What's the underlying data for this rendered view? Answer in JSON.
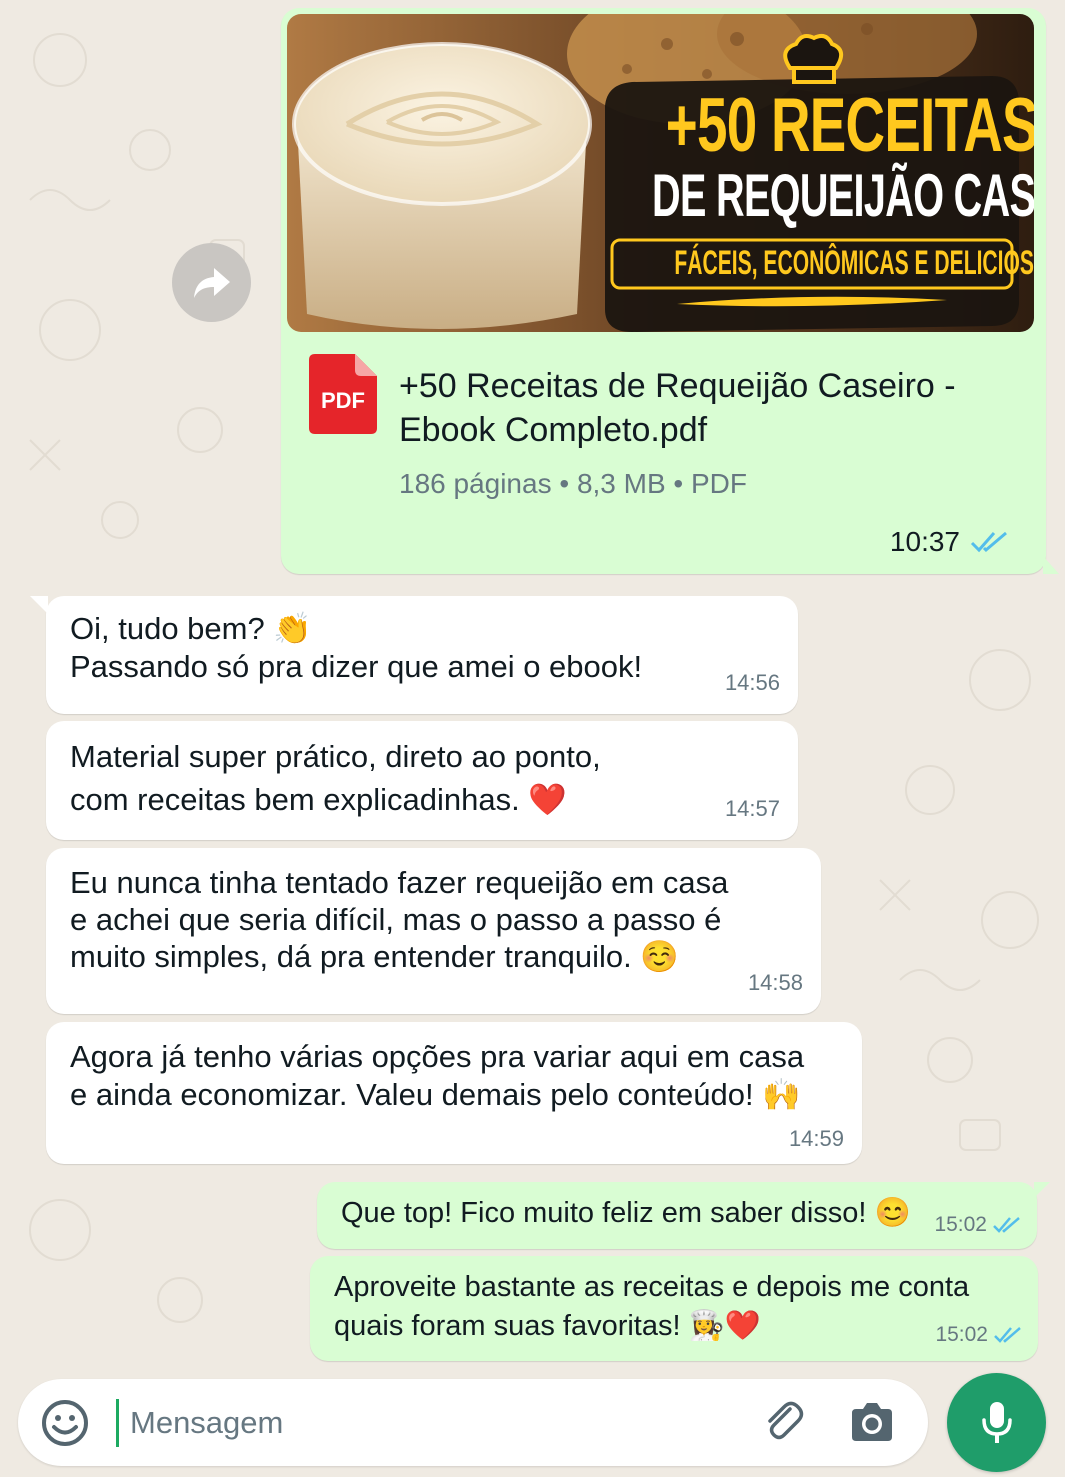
{
  "colors": {
    "background": "#efeae2",
    "outgoing_bubble": "#d9fdd3",
    "incoming_bubble": "#ffffff",
    "read_ticks": "#53bdeb",
    "accent": "#1f9d6a",
    "pdf_red": "#e5252a"
  },
  "document_message": {
    "thumbnail": {
      "title_line1": "+50 RECEITAS",
      "title_line2": "DE REQUEIJÃO CASEIRO",
      "subtitle": "FÁCEIS, ECONÔMICAS E DELICIOSAS"
    },
    "file_icon_label": "PDF",
    "file_name": "+50 Receitas de Requeijão Caseiro - Ebook Completo.pdf",
    "file_meta": "186 páginas • 8,3 MB • PDF",
    "time": "10:37",
    "status": "read"
  },
  "incoming_messages": [
    {
      "text": "Oi, tudo bem? 👏\nPassando só pra dizer que amei o ebook!",
      "time": "14:56"
    },
    {
      "text": "Material super prático, direto ao ponto,\ncom receitas bem explicadinhas. ❤️",
      "time": "14:57"
    },
    {
      "text": "Eu nunca tinha tentado fazer requeijão em casa\ne achei que seria difícil, mas o passo a passo é\nmuito simples, dá pra entender tranquilo. ☺️",
      "time": "14:58"
    },
    {
      "text": "Agora já tenho várias opções pra variar aqui em casa\ne ainda economizar. Valeu demais pelo conteúdo! 🙌",
      "time": "14:59"
    }
  ],
  "outgoing_messages": [
    {
      "text": "Que top! Fico muito feliz em saber disso! 😊",
      "time": "15:02",
      "status": "read"
    },
    {
      "text": "Aproveite bastante as receitas e depois me conta\nquais foram suas favoritas! 👩‍🍳❤️",
      "time": "15:02",
      "status": "read"
    }
  ],
  "composer": {
    "placeholder": "Mensagem",
    "icons": [
      "emoji-icon",
      "paperclip-icon",
      "camera-icon",
      "microphone-icon"
    ]
  }
}
